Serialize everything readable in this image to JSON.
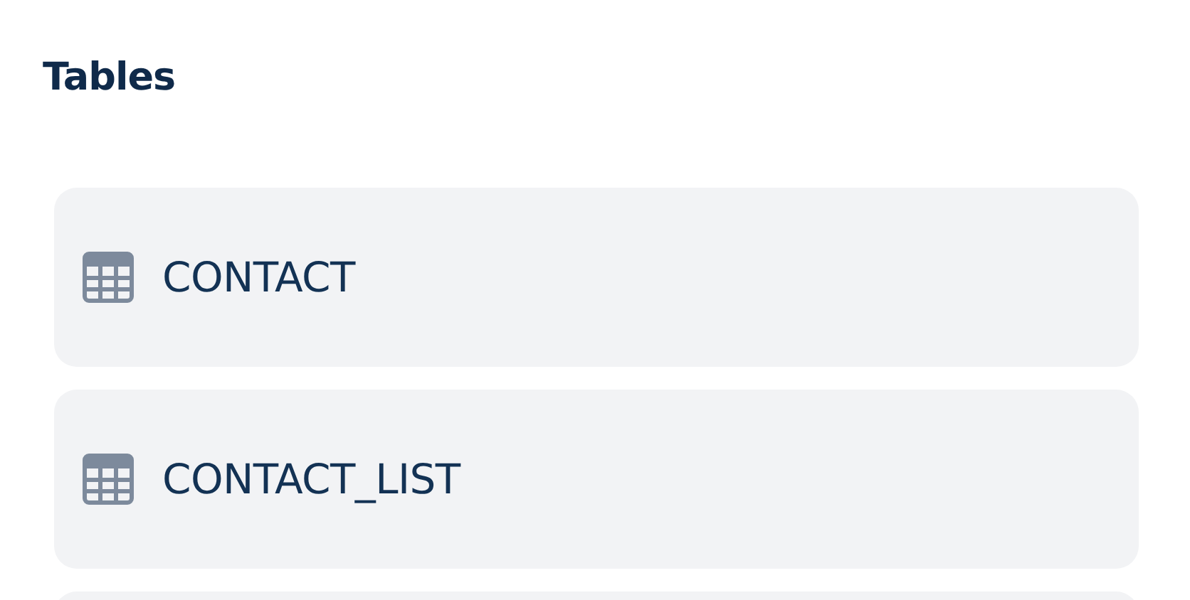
{
  "section": {
    "title": "Tables"
  },
  "tables": [
    {
      "name": "CONTACT"
    },
    {
      "name": "CONTACT_LIST"
    }
  ],
  "list_continues": true
}
